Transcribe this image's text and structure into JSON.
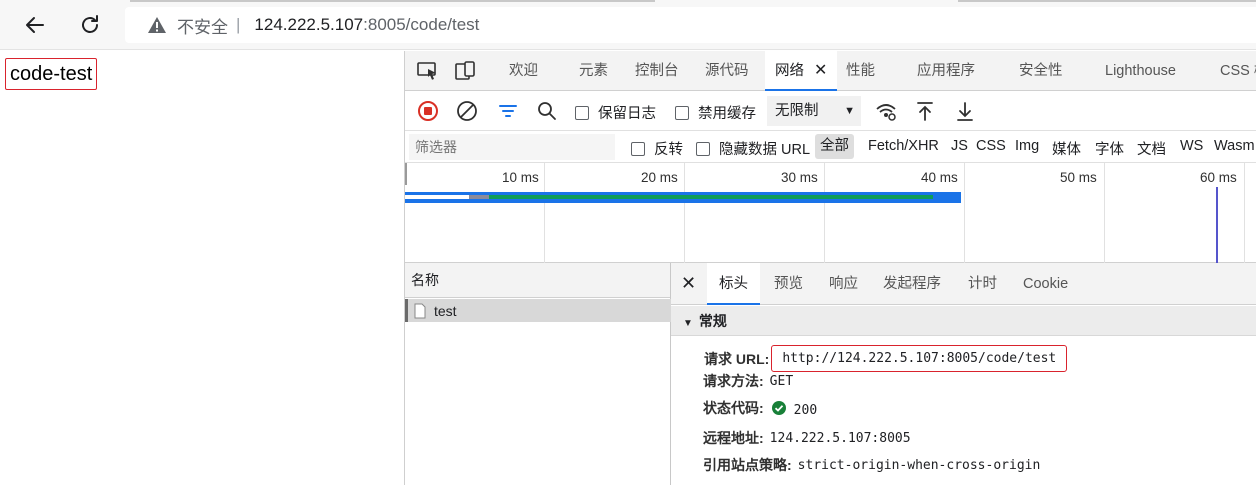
{
  "browser": {
    "security_label": "不安全",
    "url_host": "124.222.5.107",
    "url_path": ":8005/code/test"
  },
  "page": {
    "text": "code-test"
  },
  "devtools": {
    "tabs": [
      "欢迎",
      "元素",
      "控制台",
      "源代码",
      "网络",
      "性能",
      "应用程序",
      "安全性",
      "Lighthouse",
      "CSS 概"
    ],
    "active_tab_close": "✕",
    "network_toolbar": {
      "preserve_log": "保留日志",
      "disable_cache": "禁用缓存",
      "throttle": "无限制"
    },
    "filter": {
      "placeholder": "筛选器",
      "invert": "反转",
      "hide_data_urls": "隐藏数据 URL",
      "types": [
        "全部",
        "Fetch/XHR",
        "JS",
        "CSS",
        "Img",
        "媒体",
        "字体",
        "文档",
        "WS",
        "Wasm"
      ]
    },
    "overview": {
      "ticks": [
        "10 ms",
        "20 ms",
        "30 ms",
        "40 ms",
        "50 ms",
        "60 ms"
      ]
    },
    "request_list": {
      "header": "名称",
      "rows": [
        "test"
      ]
    },
    "details": {
      "close": "✕",
      "tabs": [
        "标头",
        "预览",
        "响应",
        "发起程序",
        "计时",
        "Cookie"
      ],
      "section_title": "常规",
      "general": [
        {
          "key": "请求 URL:",
          "value": "http://124.222.5.107:8005/code/test"
        },
        {
          "key": "请求方法:",
          "value": "GET"
        },
        {
          "key": "状态代码:",
          "value": "200"
        },
        {
          "key": "远程地址:",
          "value": "124.222.5.107:8005"
        },
        {
          "key": "引用站点策略:",
          "value": "strict-origin-when-cross-origin"
        }
      ],
      "status_color": "#188038"
    }
  }
}
